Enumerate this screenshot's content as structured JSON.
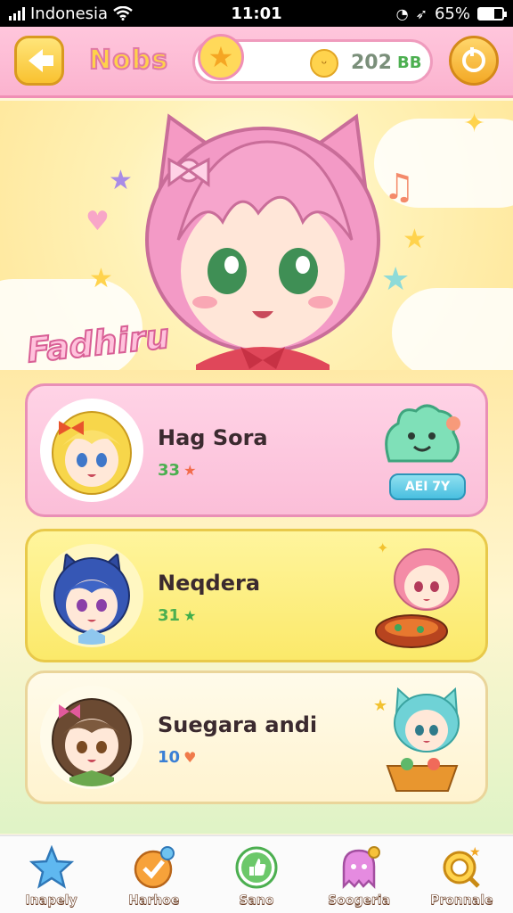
{
  "status_bar": {
    "carrier": "Indonesia",
    "time": "11:01",
    "battery": "65%",
    "battery_level": 0.65
  },
  "top_bar": {
    "title": "Nobs",
    "currency_value": "202",
    "currency_suffix": "BB"
  },
  "hero": {
    "label": "Fadhiru"
  },
  "friends": [
    {
      "name": "Hag Sora",
      "stat": "33",
      "action_label": "AEI 7Y"
    },
    {
      "name": "Neqdera",
      "stat": "31"
    },
    {
      "name": "Suegara andi",
      "stat": "10"
    }
  ],
  "bottom_nav": [
    {
      "label": "Inapely",
      "icon": "star-icon"
    },
    {
      "label": "Harhoe",
      "icon": "heart-badge-icon"
    },
    {
      "label": "Sano",
      "icon": "thumbs-up-icon"
    },
    {
      "label": "Soogeria",
      "icon": "ghost-icon"
    },
    {
      "label": "Pronnale",
      "icon": "profile-search-icon"
    }
  ],
  "colors": {
    "top_bar": "#fbb3cf",
    "card_pink": "#fbbed8",
    "card_yellow": "#fbe96a",
    "card_cream": "#fff3cf",
    "accent_yellow": "#f9c230"
  }
}
